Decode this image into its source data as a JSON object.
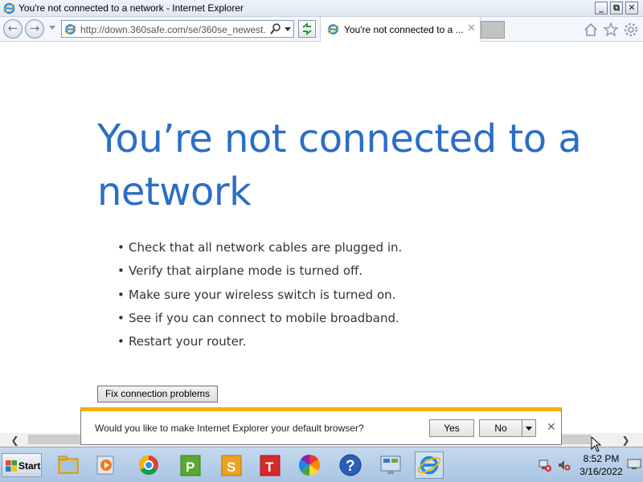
{
  "window": {
    "title": "You're not connected to a network - Internet Explorer",
    "minimize": "_",
    "restore": "⧉",
    "close": "✕"
  },
  "nav": {
    "back_icon": "back-arrow-icon",
    "forward_icon": "forward-arrow-icon",
    "address_value": "http://down.360safe.com/se/360se_newest.",
    "tab_title": "You're not connected to a ...",
    "tab_close": "✕"
  },
  "page": {
    "heading": "You’re not connected to a network",
    "bullets": [
      "Check that all network cables are plugged in.",
      "Verify that airplane mode is turned off.",
      "Make sure your wireless switch is turned on.",
      "See if you can connect to mobile broadband.",
      "Restart your router."
    ],
    "fix_button": "Fix connection problems"
  },
  "notification": {
    "message": "Would you like to make Internet Explorer your default browser?",
    "yes_label": "Yes",
    "no_label": "No",
    "close": "✕"
  },
  "scrollbar": {
    "left_arrow": "❮",
    "right_arrow": "❯"
  },
  "taskbar": {
    "start_label": "Start",
    "pinned": [
      "file-explorer-icon",
      "media-player-icon",
      "chrome-icon",
      "p-app-icon",
      "s-app-icon",
      "t-app-icon",
      "color-wheel-icon",
      "help-icon",
      "control-panel-icon",
      "internet-explorer-icon"
    ],
    "clock_time": "8:52 PM",
    "clock_date": "3/16/2022"
  },
  "colors": {
    "heading": "#2c6ec6",
    "notification_accent": "#f0b400",
    "taskbar": "#b6cde8"
  }
}
